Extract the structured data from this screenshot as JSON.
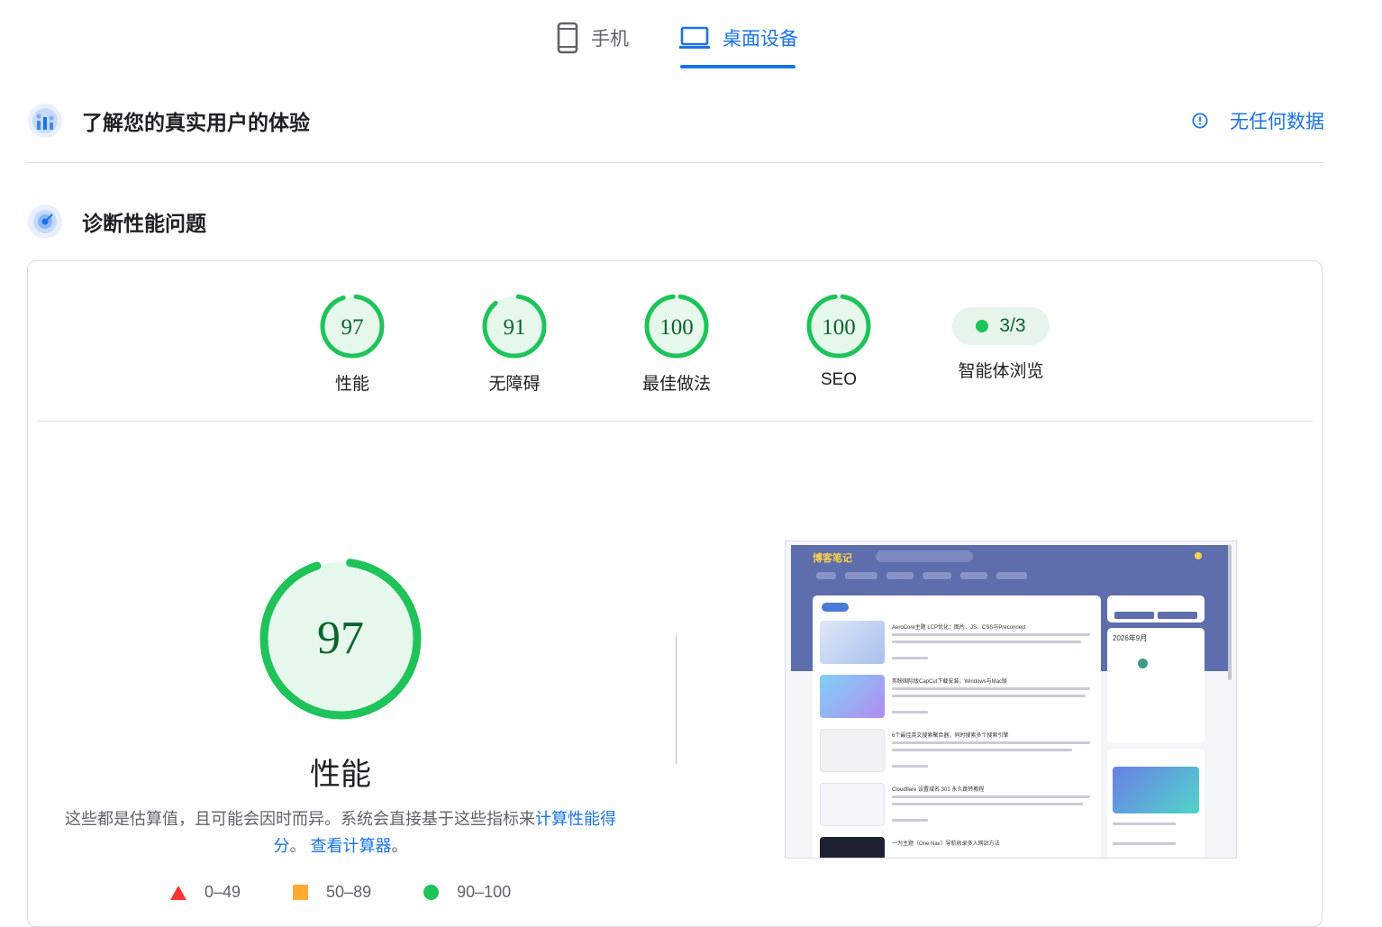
{
  "tabs": {
    "mobile": "手机",
    "desktop": "桌面设备"
  },
  "field_section": {
    "title": "了解您的真实用户的体验",
    "no_data": "无任何数据"
  },
  "diagnose_section": {
    "title": "诊断性能问题"
  },
  "scores": [
    {
      "label": "性能",
      "value": "97",
      "score": 97
    },
    {
      "label": "无障碍",
      "value": "91",
      "score": 91
    },
    {
      "label": "最佳做法",
      "value": "100",
      "score": 100
    },
    {
      "label": "SEO",
      "value": "100",
      "score": 100
    }
  ],
  "agent": {
    "label": "智能体浏览",
    "value": "3/3"
  },
  "performance": {
    "value": "97",
    "score": 97,
    "label": "性能",
    "desc_prefix": "这些都是估算值，且可能会因时而异。系统会直接基于这些指标来",
    "desc_link1": "计算性能得分",
    "desc_mid": "。",
    "desc_link2": "查看计算器",
    "desc_suffix": "。"
  },
  "legend": {
    "fail": "0–49",
    "average": "50–89",
    "pass": "90–100"
  },
  "colors": {
    "pass": "#1ec35a",
    "pass_bg": "#e6f8ec",
    "link": "#1a73e8",
    "average": "#ffaa33",
    "fail": "#ff3333"
  },
  "thumbnail": {
    "site_name": "博客笔记",
    "calendar_title": "2026年9月",
    "posts": [
      {
        "title": "AeroCore主题 LCP优化：图片、JS、CSS与Preconnect"
      },
      {
        "title": "剪映国际版CapCut下载安装，Windows与Mac版"
      },
      {
        "title": "6个最佳英文搜索聚合器，同时搜索多个搜索引擎"
      },
      {
        "title": "Cloudflare 设置域名 301 永久跳转教程"
      },
      {
        "title": "一为主题（One Nav）导航收录多入网站方法"
      }
    ]
  }
}
